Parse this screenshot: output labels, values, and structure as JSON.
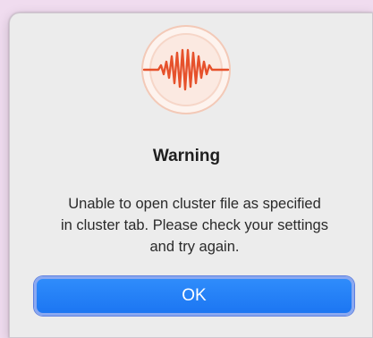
{
  "dialog": {
    "icon": "sound-wave-icon",
    "title": "Warning",
    "message_lines": [
      "Unable to open cluster file as specified",
      "in cluster tab. Please check your settings",
      "and try again."
    ],
    "ok_label": "OK"
  },
  "colors": {
    "accent": "#1c76f2",
    "icon_wave": "#e6512b",
    "desktop": "#f0dcef"
  }
}
